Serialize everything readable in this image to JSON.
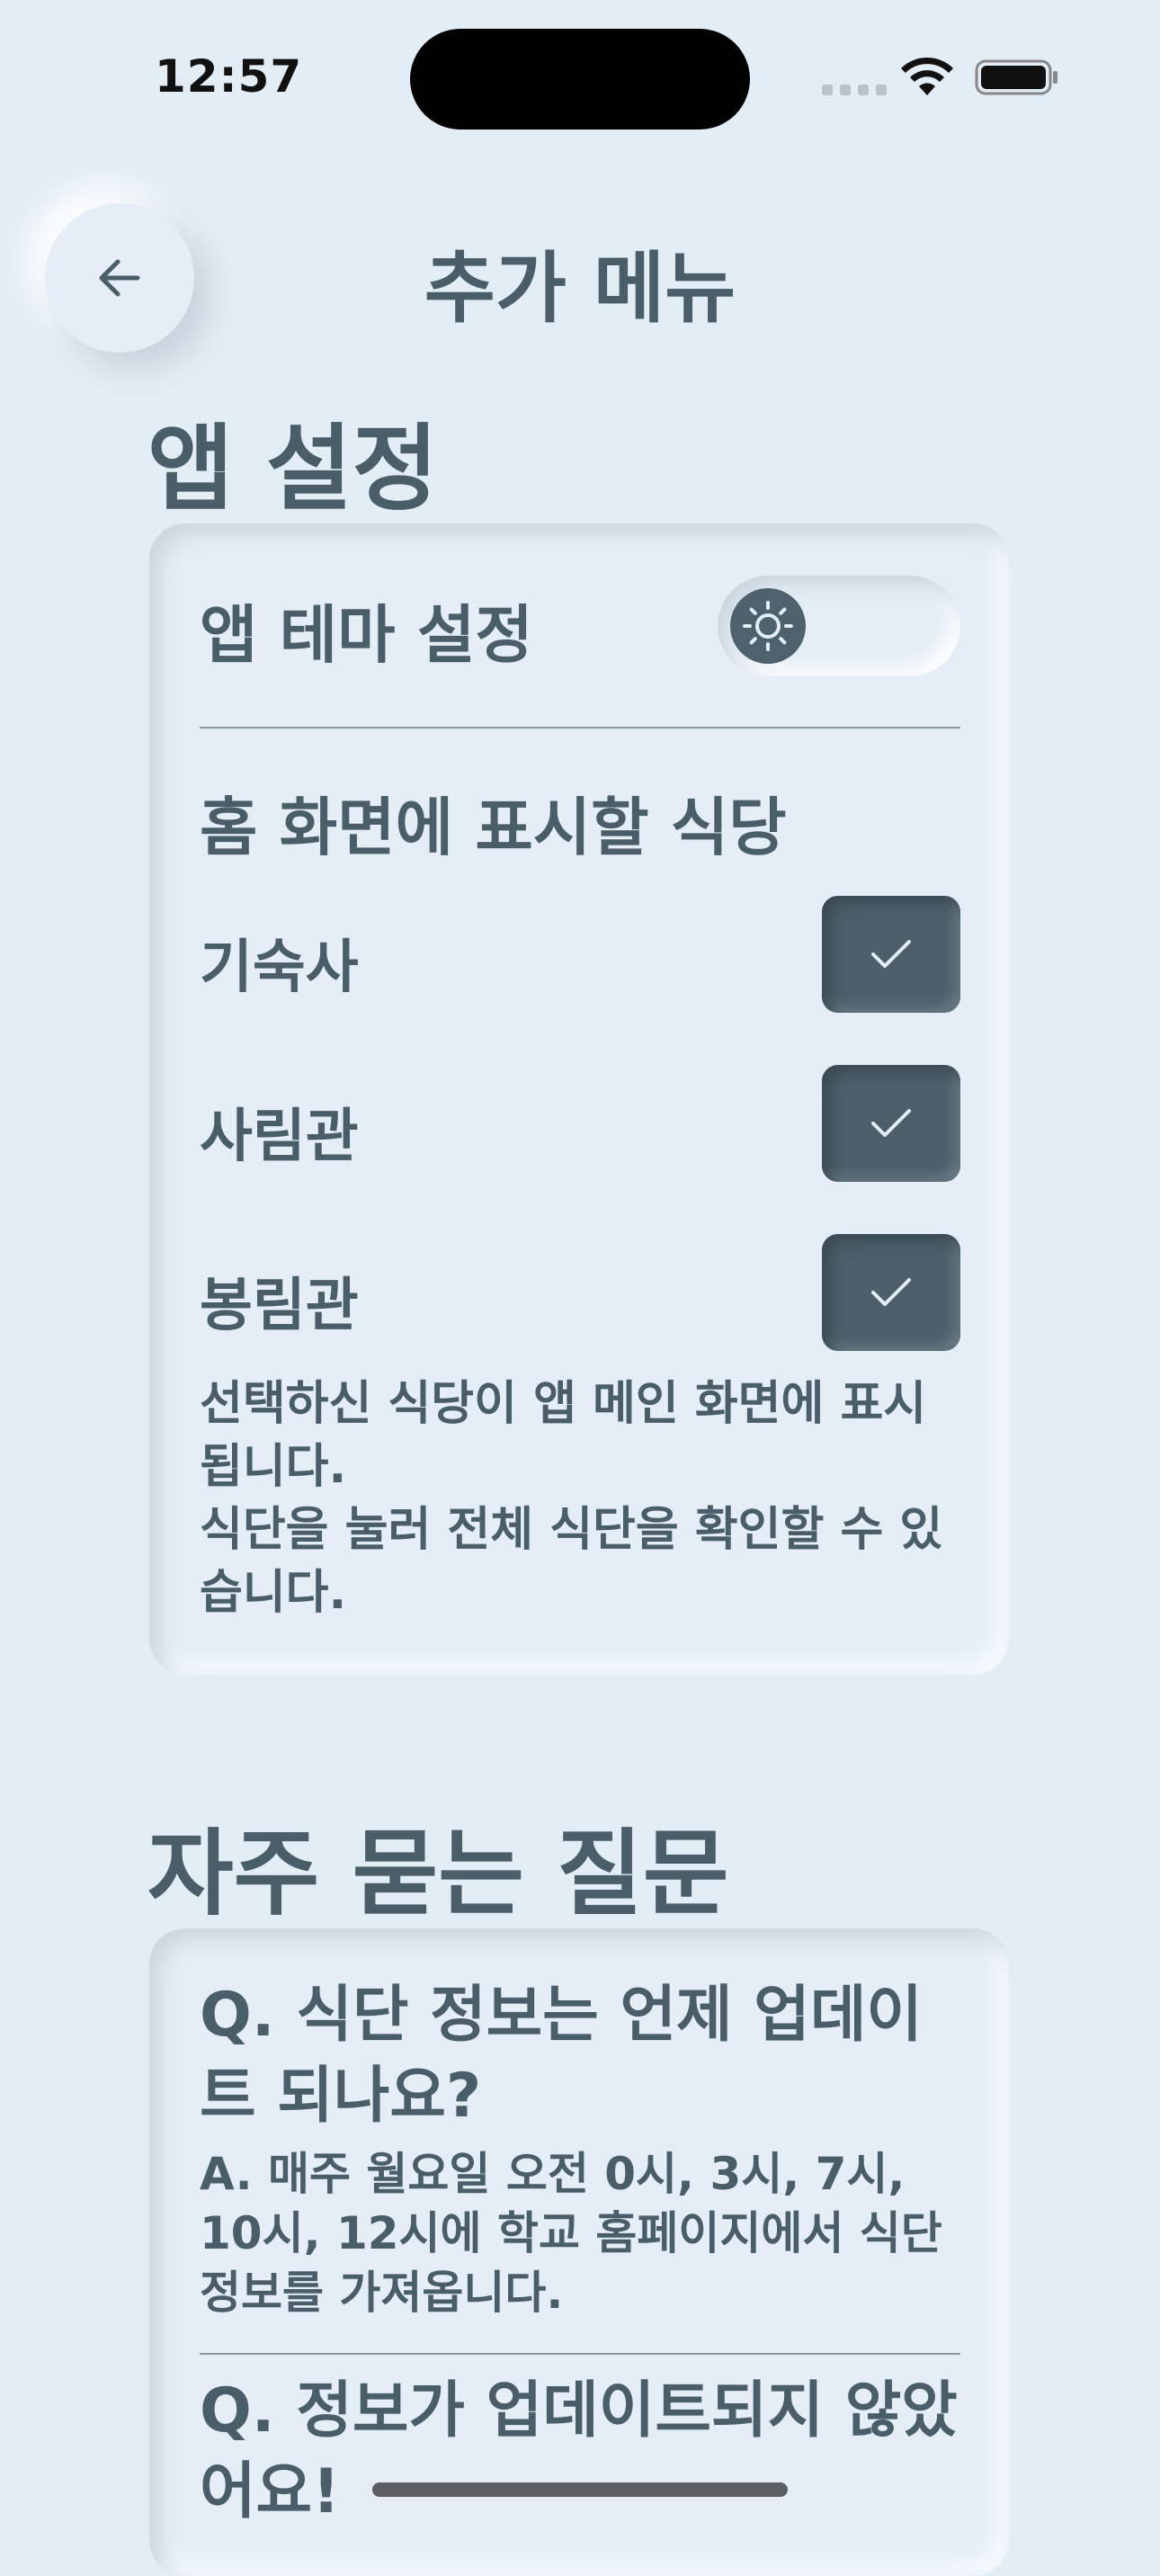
{
  "status_bar": {
    "time": "12:57"
  },
  "header": {
    "title": "추가 메뉴",
    "back_icon": "arrow-left-icon"
  },
  "app_settings": {
    "section_title": "앱 설정",
    "theme_label": "앱 테마 설정",
    "theme_icon": "sun-icon",
    "home_display_label": "홈 화면에 표시할 식당",
    "restaurants": [
      {
        "name": "기숙사",
        "checked": true
      },
      {
        "name": "사림관",
        "checked": true
      },
      {
        "name": "봉림관",
        "checked": true
      }
    ],
    "note_line1": "선택하신 식당이 앱 메인 화면에 표시됩니다.",
    "note_line2": "식단을 눌러 전체 식단을 확인할 수 있습니다."
  },
  "faq": {
    "section_title": "자주 묻는 질문",
    "items": [
      {
        "question": "Q. 식단 정보는 언제 업데이트 되나요?",
        "answer": "A. 매주 월요일 오전 0시, 3시, 7시, 10시, 12시에 학교 홈페이지에서 식단 정보를 가져옵니다."
      },
      {
        "question": "Q. 정보가 업데이트되지 않았어요!",
        "answer": ""
      }
    ]
  },
  "colors": {
    "background": "#e3edf6",
    "text": "#4a5e69",
    "checkbox": "#4c5f6a"
  }
}
